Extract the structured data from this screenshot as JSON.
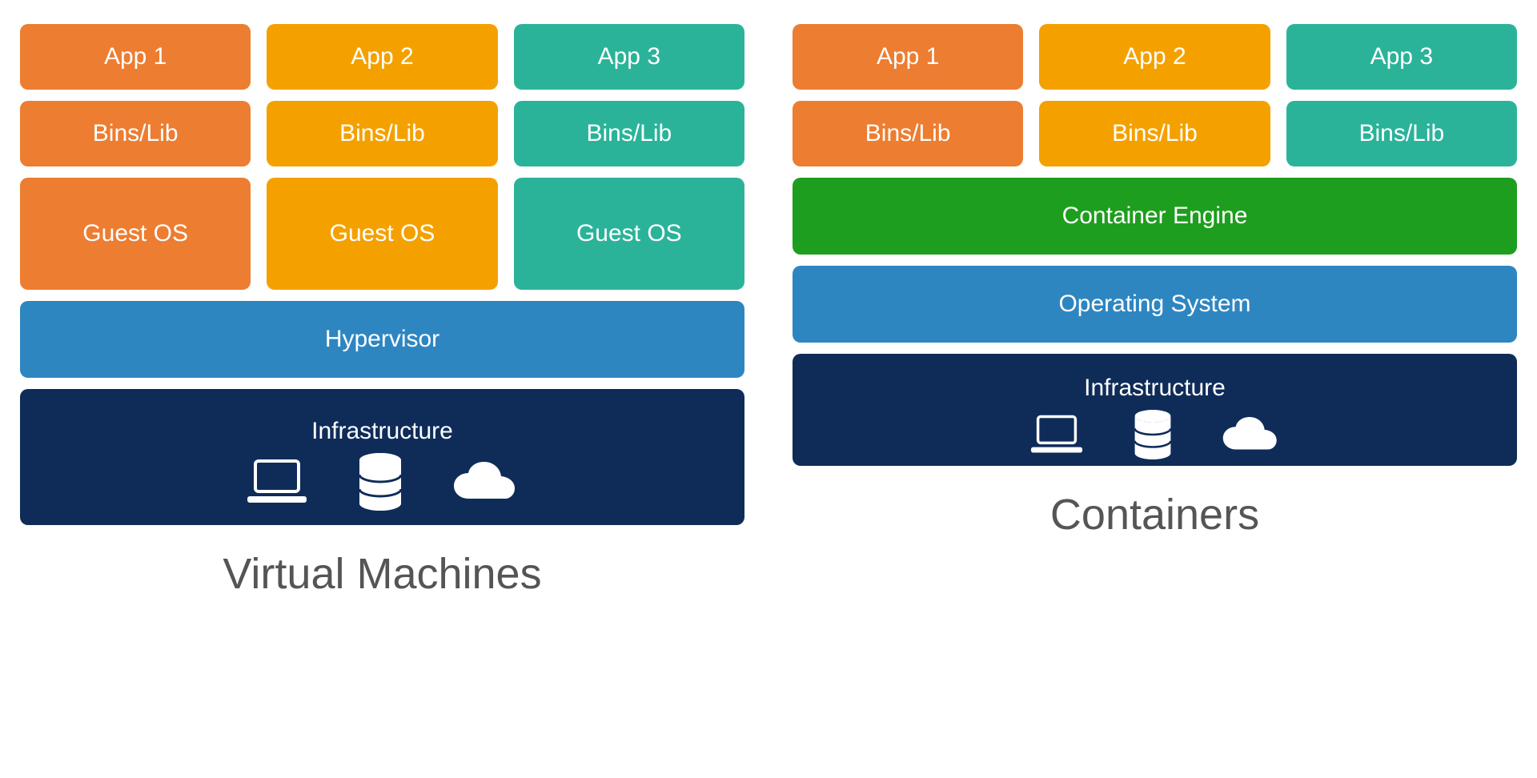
{
  "vm": {
    "caption": "Virtual Machines",
    "columns": [
      {
        "app": "App 1",
        "bins": "Bins/Lib",
        "os": "Guest OS"
      },
      {
        "app": "App 2",
        "bins": "Bins/Lib",
        "os": "Guest OS"
      },
      {
        "app": "App 3",
        "bins": "Bins/Lib",
        "os": "Guest OS"
      }
    ],
    "hypervisor": "Hypervisor",
    "infrastructure": "Infrastructure"
  },
  "containers": {
    "caption": "Containers",
    "columns": [
      {
        "app": "App 1",
        "bins": "Bins/Lib"
      },
      {
        "app": "App 2",
        "bins": "Bins/Lib"
      },
      {
        "app": "App 3",
        "bins": "Bins/Lib"
      }
    ],
    "engine": "Container Engine",
    "os": "Operating System",
    "infrastructure": "Infrastructure"
  },
  "colors": {
    "orange": "#ED7D31",
    "amber": "#F4A100",
    "teal": "#2BB39A",
    "blue": "#2E86C1",
    "navy": "#0F2C59",
    "green": "#1E9E1E"
  }
}
